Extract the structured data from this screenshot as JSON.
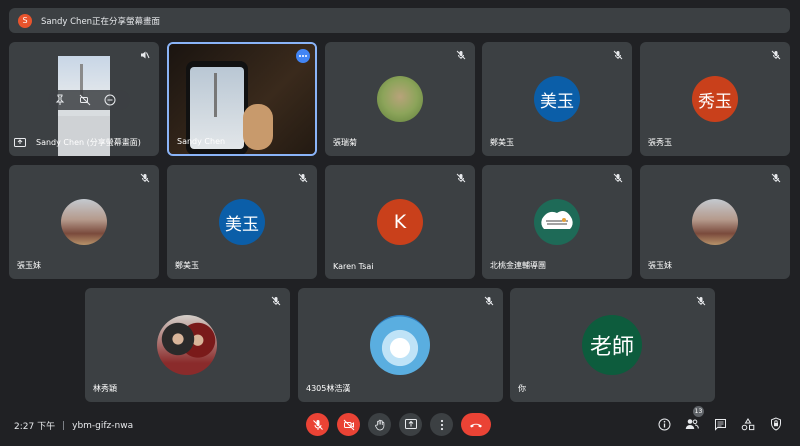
{
  "banner": {
    "avatar_initial": "S",
    "text": "Sandy Chen正在分享螢幕畫面"
  },
  "tiles": [
    {
      "name": "Sandy Chen (分享螢幕畫面)"
    },
    {
      "name": "Sandy Chen"
    },
    {
      "name": "張瑞菊"
    },
    {
      "name": "鄭美玉",
      "initials": "美玉"
    },
    {
      "name": "張秀玉",
      "initials": "秀玉"
    },
    {
      "name": "張玉妹"
    },
    {
      "name": "鄭美玉",
      "initials": "美玉"
    },
    {
      "name": "Karen Tsai",
      "initials": "K"
    },
    {
      "name": "北桃金連輔導團"
    },
    {
      "name": "張玉妹"
    },
    {
      "name": "林秀穎"
    },
    {
      "name": "4305林浩漢"
    },
    {
      "name": "你",
      "initials": "老師"
    }
  ],
  "footer": {
    "time": "2:27 下午",
    "separator": "|",
    "meeting_code": "ybm-gifz-nwa",
    "participant_count": "13"
  },
  "colors": {
    "avatar_blue": "#0b5ea8",
    "avatar_orange": "#c9401b",
    "avatar_green": "#0d5c3d",
    "hangup_red": "#ea4335"
  }
}
